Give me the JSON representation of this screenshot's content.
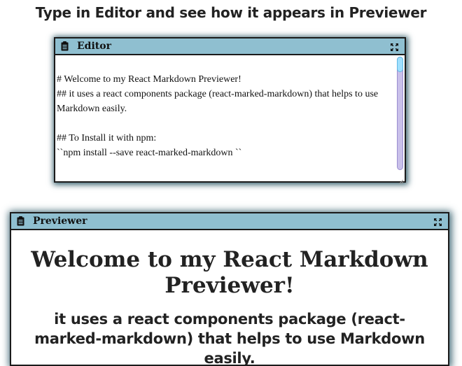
{
  "page": {
    "title": "Type in Editor and see how it appears in Previewer"
  },
  "editor": {
    "title": "Editor",
    "icon": "clipboard-icon",
    "maximize_icon": "expand-arrows-icon",
    "content": "# Welcome to my React Markdown Previewer!\n## it uses a react components package (react-marked-markdown) that helps to use Markdown easily.\n\n## To Install it with npm:\n``npm install --save react-marked-markdown ``"
  },
  "previewer": {
    "title": "Previewer",
    "icon": "clipboard-icon",
    "maximize_icon": "expand-arrows-icon",
    "h1": "Welcome to my React Markdown Previewer!",
    "h2": "it uses a react components package (react-marked-markdown) that helps to use Markdown easily."
  },
  "colors": {
    "toolbar_bg": "#8fbfd0",
    "border": "#1b1b1b",
    "shadow": "#3b6471",
    "scroll_track": "#c9c0ea",
    "scroll_thumb": "#9fe0ff"
  }
}
